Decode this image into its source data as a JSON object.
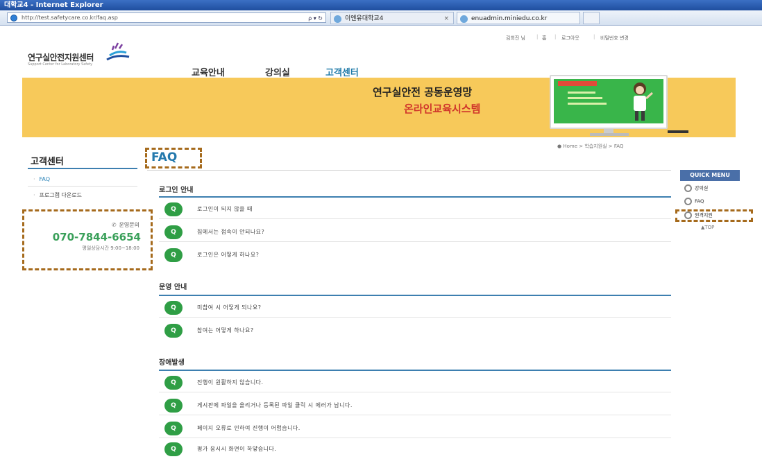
{
  "browser": {
    "title": "대학교4 - Internet Explorer",
    "url": "http://test.safetycare.co.kr/faq.asp",
    "url_controls": "ρ ▾ ↻",
    "tab_active": "이엔유대학교4",
    "tab_active_close": "×",
    "tab_second": "enuadmin.miniedu.co.kr"
  },
  "site": {
    "logo_text": "연구실안전지원센터",
    "logo_sub": "Support Center for Laboratory Safety",
    "util_links": [
      "김희진 님",
      "홈",
      "로그아웃",
      "비밀번호 변경"
    ],
    "nav": [
      "교육안내",
      "강의실",
      "고객센터"
    ],
    "nav_active": "고객센터"
  },
  "banner": {
    "title_line1": "연구실안전 공동운영망",
    "title_line2": "온라인교육시스템"
  },
  "breadcrumb": "● Home > 학습지원실 > FAQ",
  "sidebar": {
    "title": "고객센터",
    "items": [
      {
        "label": "FAQ",
        "active": true
      },
      {
        "label": "프로그램 다운로드",
        "active": false
      }
    ],
    "contact": {
      "label": "운영문의",
      "phone": "070-7844-6654",
      "hours": "평일상담시간 9:00~18:00"
    }
  },
  "main": {
    "page_title": "FAQ",
    "sections": [
      {
        "title": "로그인 안내",
        "items": [
          "로그인이 되지 않을 때",
          "집에서는 접속이 안되나요?",
          "로그인은 어떻게 하나요?"
        ]
      },
      {
        "title": "운영 안내",
        "items": [
          "미참여 시 어떻게 되나요?",
          "참여는 어떻게 하나요?"
        ]
      },
      {
        "title": "장애발생",
        "items": [
          "진행이 원활하지 않습니다.",
          "게시판에 파일을 올리거나 등록된 파일 클릭 시 에러가 납니다.",
          "페이지 오류로 인하여 진행이 어렵습니다.",
          "평가 응시시 화면이 하얗습니다."
        ]
      }
    ],
    "q_badge": "Q"
  },
  "quick_menu": {
    "title": "QUICK MENU",
    "items": [
      "강의실",
      "FAQ",
      "원격지원"
    ],
    "top": "▲TOP"
  },
  "colors": {
    "accent_blue": "#2479ad",
    "banner_yellow": "#f7c95a",
    "q_green": "#2f9e45",
    "annotation_brown": "#a56a1c",
    "phone_green": "#3aa05a"
  }
}
